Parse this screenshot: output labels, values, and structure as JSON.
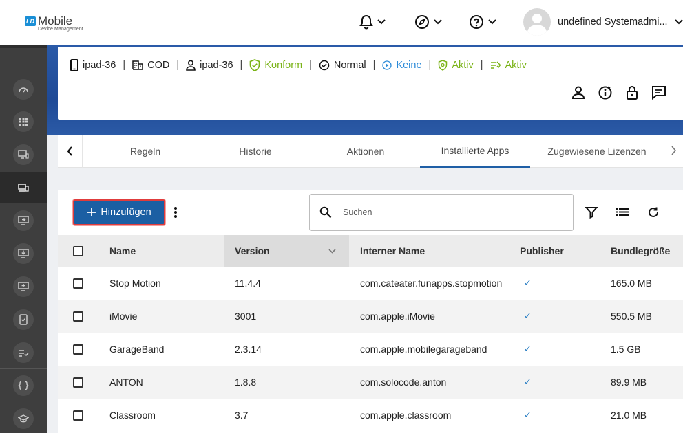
{
  "app": {
    "logo_badge": "LD",
    "logo_name": "Mobile",
    "logo_sub": "Device Management"
  },
  "topbar": {
    "user_name": "undefined Systemadmi..."
  },
  "device": {
    "name": "ipad-36",
    "ownership": "COD",
    "user": "ipad-36",
    "compliance": "Konform",
    "state": "Normal",
    "lost_mode": "Keine",
    "protection": "Aktiv",
    "policy": "Aktiv"
  },
  "tabs": [
    {
      "label": "Regeln"
    },
    {
      "label": "Historie"
    },
    {
      "label": "Aktionen"
    },
    {
      "label": "Installierte Apps"
    },
    {
      "label": "Zugewiesene Lizenzen"
    }
  ],
  "toolbar": {
    "add_label": "Hinzufügen",
    "search_placeholder": "Suchen"
  },
  "table": {
    "columns": [
      "Name",
      "Version",
      "Interner Name",
      "Publisher",
      "Bundlegröße"
    ],
    "rows": [
      {
        "name": "Stop Motion",
        "version": "11.4.4",
        "internal": "com.cateater.funapps.stopmotion",
        "publisher": "✓",
        "size": "165.0 MB"
      },
      {
        "name": "iMovie",
        "version": "3001",
        "internal": "com.apple.iMovie",
        "publisher": "✓",
        "size": "550.5 MB"
      },
      {
        "name": "GarageBand",
        "version": "2.3.14",
        "internal": "com.apple.mobilegarageband",
        "publisher": "✓",
        "size": "1.5 GB"
      },
      {
        "name": "ANTON",
        "version": "1.8.8",
        "internal": "com.solocode.anton",
        "publisher": "✓",
        "size": "89.9 MB"
      },
      {
        "name": "Classroom",
        "version": "3.7",
        "internal": "com.apple.classroom",
        "publisher": "✓",
        "size": "21.0 MB"
      }
    ]
  },
  "colors": {
    "primary": "#1b5fa3",
    "success": "#7ab317",
    "info": "#2b8ad8",
    "sidebar": "#3e3e3e"
  }
}
